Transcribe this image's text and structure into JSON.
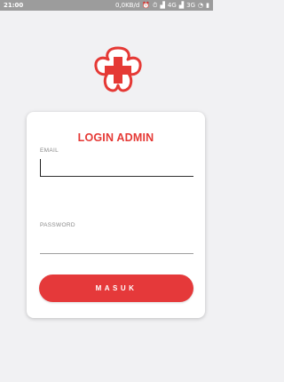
{
  "status_bar": {
    "time": "21:00",
    "speed": "0,0KB/d",
    "network_1": "4G",
    "network_2": "3G"
  },
  "colors": {
    "accent": "#e53935",
    "status_bar": "#9c9c9c",
    "background": "#f1f1f3",
    "card": "#ffffff"
  },
  "logo": {
    "icon": "red-cross-flower-logo-icon"
  },
  "login": {
    "title": "LOGIN ADMIN",
    "email_label": "EMAIL",
    "email_value": "",
    "email_placeholder": "",
    "password_label": "PASSWORD",
    "password_value": "",
    "password_placeholder": "",
    "submit_label": "MASUK"
  }
}
